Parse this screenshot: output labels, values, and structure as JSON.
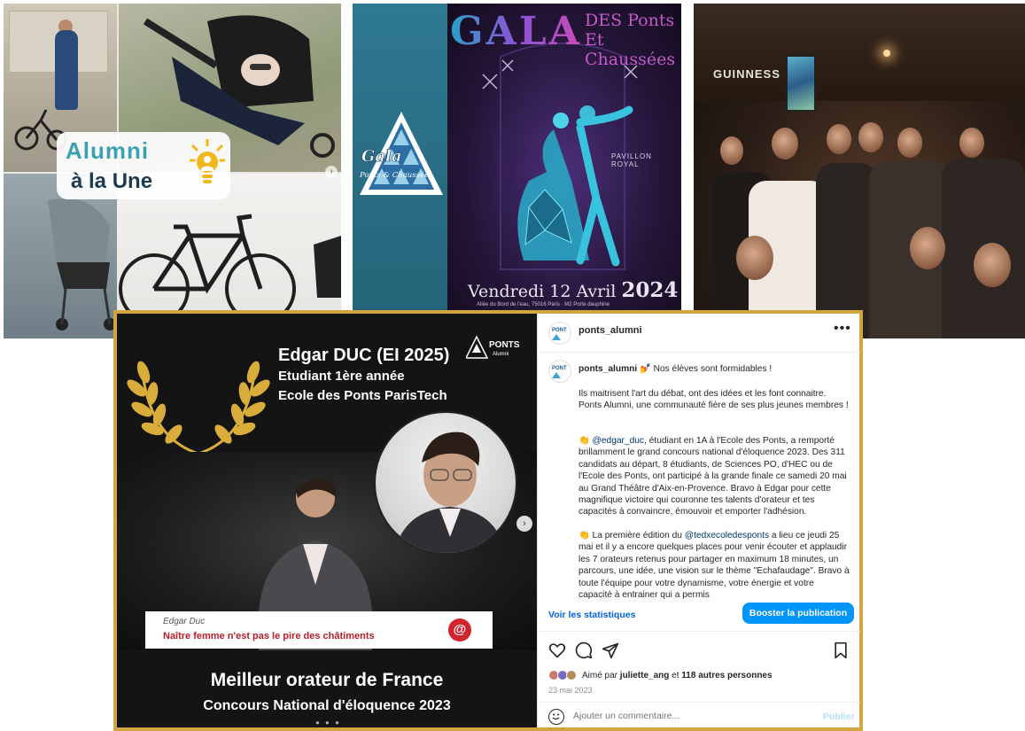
{
  "tile_alumni": {
    "line1": "Alumni",
    "line2": "à la Une"
  },
  "tile_gala": {
    "title": "GALA",
    "subtitle_line1": "DES Ponts",
    "subtitle_line2": "Et Chaussées",
    "logo_text_1": "Gala",
    "logo_text_2": "Ponts & Chaussées",
    "venue": "PAVILLON ROYAL",
    "date": "Vendredi 12 Avril",
    "year": "2024",
    "address": "Allée du Bord de l'eau, 75016 Paris · M2 Porte dauphine"
  },
  "tile_party": {
    "sign": "GUINNESS"
  },
  "post_image": {
    "name": "Edgar DUC (EI 2025)",
    "line2": "Etudiant 1ère année",
    "line3": "Ecole des Ponts ParisTech",
    "logo_text": "PONTS",
    "logo_sub": "Alumni",
    "caption_speaker": "Edgar Duc",
    "caption_quote": "Naître femme n'est pas le pire des châtiments",
    "title1": "Meilleur orateur de France",
    "title2": "Concours National d'éloquence 2023"
  },
  "post": {
    "username": "ponts_alumni",
    "more_icon": "•••",
    "caption_user": "ponts_alumni",
    "caption_intro": "💅 Nos élèves sont formidables !",
    "para1": "Ils maitrisent l'art du débat, ont des idées et les font connaitre. Ponts Alumni, une communauté fière de ses plus jeunes membres !",
    "para2_emoji": "👏",
    "para2_mention": "@edgar_duc",
    "para2_rest": ", étudiant en 1A à l'Ecole des Ponts, a remporté brillamment le grand concours national d'éloquence 2023. Des 311 candidats au départ, 8 étudiants, de Sciences PO, d'HEC ou de l'Ecole des Ponts, ont participé à la grande finale ce samedi 20 mai au Grand Théâtre d'Aix-en-Provence. Bravo à Edgar pour cette magnifique victoire qui couronne tes talents d'orateur et tes capacités à convaincre, émouvoir et emporter l'adhésion.",
    "para3_emoji": "👏",
    "para3_pre": "La première édition du ",
    "para3_mention": "@tedxecoledesponts",
    "para3_rest": " a lieu ce jeudi 25 mai et il y a encore quelques places pour venir écouter et applaudir les 7 orateurs retenus pour partager en maximum 18 minutes, un parcours, une idée, une vision sur le thème \"Echafaudage\". Bravo à toute l'équipe pour votre dynamisme, votre énergie et votre capacité à entrainer qui a permis",
    "stats_link": "Voir les statistiques",
    "boost_button": "Booster la publication",
    "liked_prefix": "Aimé par ",
    "liked_user": "juliette_ang",
    "liked_mid": " et ",
    "liked_count": "118 autres personnes",
    "date": "23 mai 2023",
    "comment_placeholder": "Ajouter un commentaire...",
    "publish_button": "Publier"
  },
  "colors": {
    "frame_gold": "#d1a641",
    "instagram_blue": "#0095f6",
    "link_blue": "#00376b",
    "quote_red": "#b51e2a"
  }
}
